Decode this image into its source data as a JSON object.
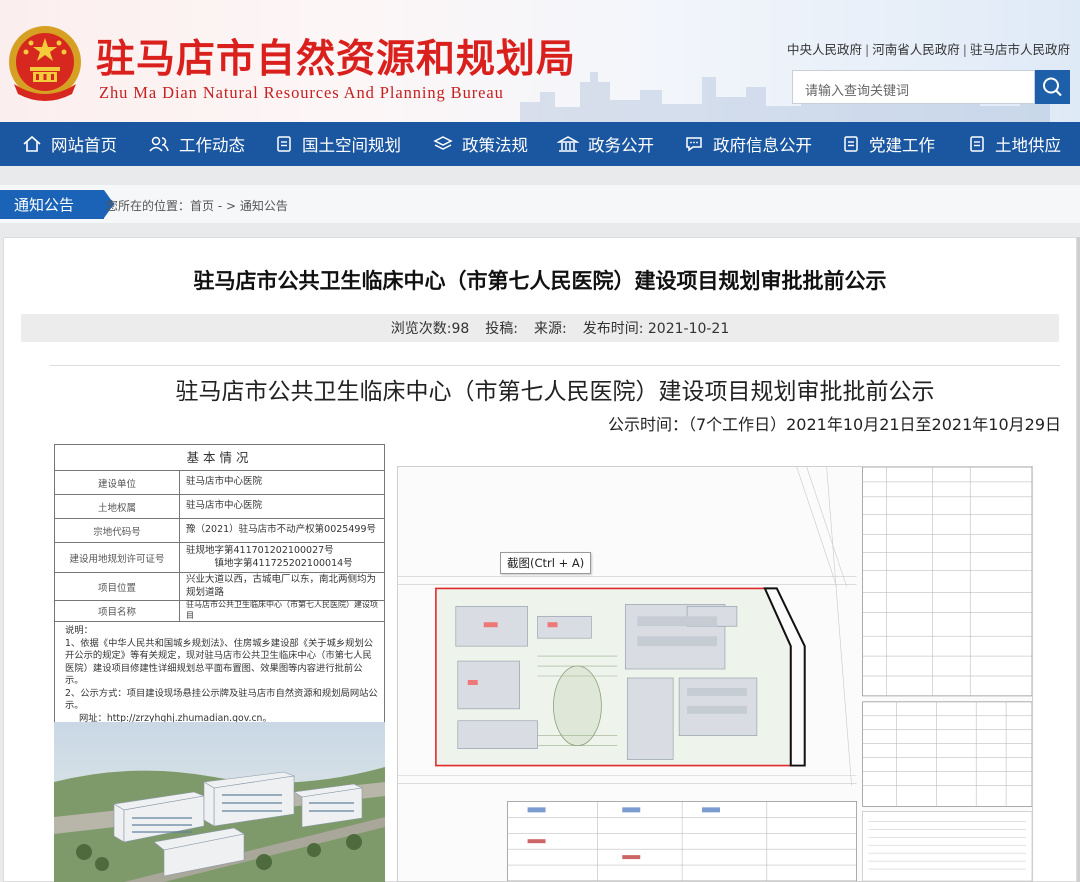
{
  "header": {
    "title": "驻马店市自然资源和规划局",
    "subtitle": "Zhu Ma Dian Natural Resources And Planning Bureau",
    "top_links": [
      "中央人民政府",
      "河南省人民政府",
      "驻马店市人民政府"
    ],
    "top_link_sep": "|",
    "search_placeholder": "请输入查询关键词"
  },
  "nav": {
    "items": [
      {
        "label": "网站首页",
        "icon": "home-icon"
      },
      {
        "label": "工作动态",
        "icon": "people-icon"
      },
      {
        "label": "国土空间规划",
        "icon": "document-icon"
      },
      {
        "label": "政策法规",
        "icon": "layers-icon"
      },
      {
        "label": "政务公开",
        "icon": "building-icon"
      },
      {
        "label": "政府信息公开",
        "icon": "chat-icon"
      },
      {
        "label": "党建工作",
        "icon": "document-icon"
      },
      {
        "label": "土地供应",
        "icon": "document-icon"
      }
    ]
  },
  "breadcrumb": {
    "tag": "通知公告",
    "text": "您所在的位置：首页 - > 通知公告"
  },
  "article": {
    "title": "驻马店市公共卫生临床中心（市第七人民医院）建设项目规划审批批前公示",
    "views": "浏览次数:98",
    "submitter": "投稿:",
    "source": "来源:",
    "publish": "发布时间: 2021-10-21"
  },
  "document": {
    "title": "驻马店市公共卫生临床中心（市第七人民医院）建设项目规划审批批前公示",
    "time": "公示时间：（7个工作日）2021年10月21日至2021年10月29日",
    "info_heading": "基本情况",
    "info_rows": [
      {
        "k": "建设单位",
        "v": "驻马店市中心医院"
      },
      {
        "k": "土地权属",
        "v": "驻马店市中心医院"
      },
      {
        "k": "宗地代码号",
        "v": "豫（2021）驻马店市不动产权第0025499号"
      },
      {
        "k": "建设用地规划许可证号",
        "v": "驻规地字第411701202100027号\n　　　镇地字第411725202100014号"
      },
      {
        "k": "项目位置",
        "v": "兴业大道以西，古城电厂以东，南北两侧均为规划道路"
      },
      {
        "k": "项目名称",
        "v": "驻马店市公共卫生临床中心（市第七人民医院）建设项目"
      }
    ],
    "notes": [
      "说明：",
      "1、依据《中华人民共和国城乡规划法》、住房城乡建设部《关于城乡规划公开公示的规定》等有关规定，现对驻马店市公共卫生临床中心（市第七人民医院）建设项目修建性详细规划总平面布置图、效果图等内容进行批前公示。",
      "2、公示方式：项目建设现场悬挂公示牌及驻马店市自然资源和规划局网站公示。",
      "网址：http://zrzyhghj.zhumadian.gov.cn。"
    ],
    "tooltip": "截图(Ctrl + A)"
  }
}
